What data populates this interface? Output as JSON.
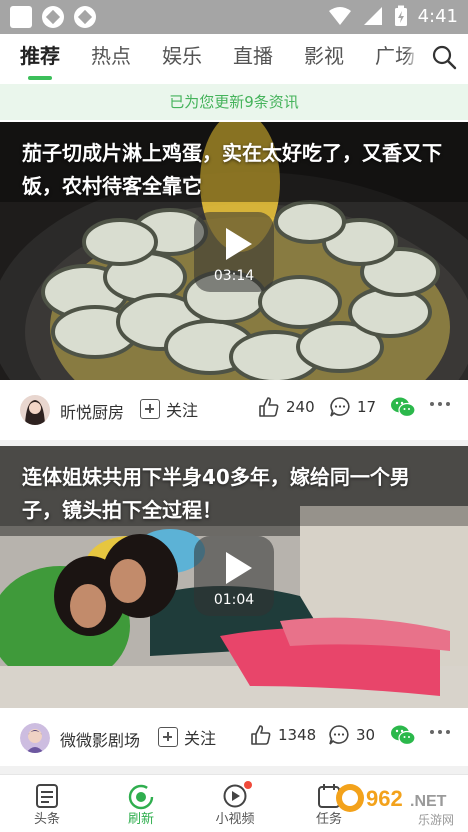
{
  "status_bar": {
    "time": "4:41"
  },
  "top_nav": {
    "tabs": [
      {
        "label": "推荐",
        "active": true
      },
      {
        "label": "热点"
      },
      {
        "label": "娱乐"
      },
      {
        "label": "直播"
      },
      {
        "label": "影视"
      },
      {
        "label": "广场"
      }
    ],
    "search_icon": "search-icon"
  },
  "banner": {
    "text": "已为您更新9条资讯"
  },
  "feed": [
    {
      "title": "茄子切成片淋上鸡蛋，实在太好吃了，又香又下饭，农村待客全靠它",
      "duration": "03:14",
      "author": "昕悦厨房",
      "follow_label": "关注",
      "likes": "240",
      "comments": "17"
    },
    {
      "title": "连体姐妹共用下半身40多年，嫁给同一个男子，镜头拍下全过程！",
      "duration": "01:04",
      "author": "微微影剧场",
      "follow_label": "关注",
      "likes": "1348",
      "comments": "30"
    }
  ],
  "bottom_tabs": [
    {
      "label": "头条",
      "icon": "news-icon"
    },
    {
      "label": "刷新",
      "icon": "refresh-icon",
      "active": true
    },
    {
      "label": "小视频",
      "icon": "video-icon",
      "badge": true
    },
    {
      "label": "任务",
      "icon": "task-icon"
    }
  ],
  "watermark": {
    "text": "962.NET",
    "sub": "乐游网"
  },
  "colors": {
    "accent": "#3cbf5a",
    "banner_bg": "#eaf6ec",
    "banner_text": "#45b35b",
    "wechat": "#2bb84b",
    "badge": "#f04a3a"
  }
}
